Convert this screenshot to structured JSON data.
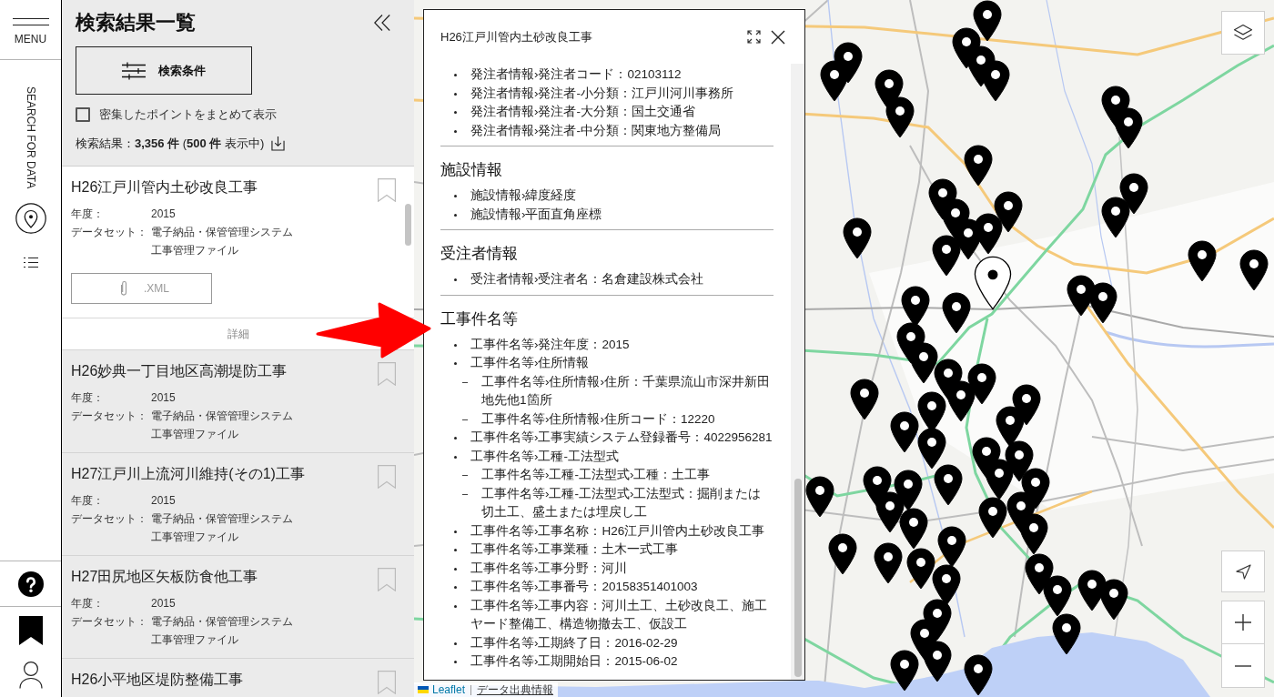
{
  "nav": {
    "menu_label": "MENU",
    "section_label": "SEARCH FOR DATA"
  },
  "results_panel": {
    "title": "検索結果一覧",
    "search_conditions_button": "検索条件",
    "cluster_option": {
      "label": "密集したポイントをまとめて表示",
      "checked": false
    },
    "summary": "検索結果：**3,356 件** (**500 件** 表示中)",
    "items": [
      {
        "title": "H26江戸川管内土砂改良工事",
        "selected": true,
        "bookmarked": false,
        "fields": [
          {
            "label": "年度：",
            "values": [
              "2015"
            ]
          },
          {
            "label": "データセット：",
            "values": [
              "電子納品・保管管理システム",
              "工事管理ファイル"
            ]
          }
        ],
        "attachment": ".XML",
        "detail_link": "詳細"
      },
      {
        "title": "H26妙典一丁目地区高潮堤防工事",
        "selected": false,
        "bookmarked": false,
        "fields": [
          {
            "label": "年度：",
            "values": [
              "2015"
            ]
          },
          {
            "label": "データセット：",
            "values": [
              "電子納品・保管管理システム",
              "工事管理ファイル"
            ]
          }
        ]
      },
      {
        "title": "H27江戸川上流河川維持(その1)工事",
        "selected": false,
        "bookmarked": false,
        "fields": [
          {
            "label": "年度：",
            "values": [
              "2015"
            ]
          },
          {
            "label": "データセット：",
            "values": [
              "電子納品・保管管理システム",
              "工事管理ファイル"
            ]
          }
        ]
      },
      {
        "title": "H27田尻地区矢板防食他工事",
        "selected": false,
        "bookmarked": false,
        "fields": [
          {
            "label": "年度：",
            "values": [
              "2015"
            ]
          },
          {
            "label": "データセット：",
            "values": [
              "電子納品・保管管理システム",
              "工事管理ファイル"
            ]
          }
        ]
      },
      {
        "title": "H26小平地区堤防整備工事",
        "selected": false,
        "bookmarked": false
      }
    ]
  },
  "popup": {
    "title": "H26江戸川管内土砂改良工事",
    "sections": [
      {
        "items": [
          {
            "text": "発注者情報›発注者コード：02103112"
          },
          {
            "text": "発注者情報›発注者-小分類：江戸川河川事務所"
          },
          {
            "text": "発注者情報›発注者-大分類：国土交通省"
          },
          {
            "text": "発注者情報›発注者-中分類：関東地方整備局"
          }
        ]
      },
      {
        "heading": "施設情報",
        "items": [
          {
            "text": "施設情報›緯度経度"
          },
          {
            "text": "施設情報›平面直角座標"
          }
        ]
      },
      {
        "heading": "受注者情報",
        "items": [
          {
            "text": "受注者情報›受注者名：名倉建設株式会社"
          }
        ]
      },
      {
        "heading": "工事件名等",
        "items": [
          {
            "text": "工事件名等›発注年度：2015"
          },
          {
            "text": "工事件名等›住所情報",
            "children": [
              {
                "text": "工事件名等›住所情報›住所：千葉県流山市深井新田地先他1箇所"
              },
              {
                "text": "工事件名等›住所情報›住所コード：12220"
              }
            ]
          },
          {
            "text": "工事件名等›工事実績システム登録番号：4022956281"
          },
          {
            "text": "工事件名等›工種-工法型式",
            "children": [
              {
                "text": "工事件名等›工種-工法型式›工種：土工事"
              },
              {
                "text": "工事件名等›工種-工法型式›工法型式：掘削または切土工、盛土または埋戻し工"
              }
            ]
          },
          {
            "text": "工事件名等›工事名称：H26江戸川管内土砂改良工事"
          },
          {
            "text": "工事件名等›工事業種：土木一式工事"
          },
          {
            "text": "工事件名等›工事分野：河川"
          },
          {
            "text": "工事件名等›工事番号：20158351401003"
          },
          {
            "text": "工事件名等›工事内容：河川土工、土砂改良工、施工ヤード整備工、構造物撤去工、仮設工"
          },
          {
            "text": "工事件名等›工期終了日：2016-02-29"
          },
          {
            "text": "工事件名等›工期開始日：2015-06-02"
          }
        ]
      }
    ]
  },
  "map": {
    "markers": [
      {
        "selected": false
      },
      {
        "selected": false
      },
      {
        "selected": false
      },
      {
        "selected": false
      },
      {
        "selected": false
      },
      {
        "selected": false
      },
      {
        "selected": false
      },
      {
        "selected": false
      },
      {
        "selected": false
      },
      {
        "selected": false
      },
      {
        "selected": false
      },
      {
        "selected": false
      },
      {
        "selected": false
      },
      {
        "selected": false
      },
      {
        "selected": false
      },
      {
        "selected": false
      },
      {
        "selected": false
      },
      {
        "selected": false
      },
      {
        "selected": false
      },
      {
        "selected": false
      },
      {
        "selected": false
      },
      {
        "selected": false
      },
      {
        "selected": true
      },
      {
        "selected": false
      },
      {
        "selected": false
      },
      {
        "selected": false
      },
      {
        "selected": false
      },
      {
        "selected": false
      },
      {
        "selected": false
      },
      {
        "selected": false
      },
      {
        "selected": false
      },
      {
        "selected": false
      },
      {
        "selected": false
      },
      {
        "selected": false
      },
      {
        "selected": false
      },
      {
        "selected": false
      },
      {
        "selected": false
      },
      {
        "selected": false
      },
      {
        "selected": false
      },
      {
        "selected": false
      },
      {
        "selected": false
      },
      {
        "selected": false
      },
      {
        "selected": false
      },
      {
        "selected": false
      },
      {
        "selected": false
      },
      {
        "selected": false
      },
      {
        "selected": false
      },
      {
        "selected": false
      },
      {
        "selected": false
      },
      {
        "selected": false
      },
      {
        "selected": false
      },
      {
        "selected": false
      },
      {
        "selected": false
      },
      {
        "selected": false
      },
      {
        "selected": false
      },
      {
        "selected": false
      },
      {
        "selected": false
      },
      {
        "selected": false
      },
      {
        "selected": false
      },
      {
        "selected": false
      },
      {
        "selected": false
      },
      {
        "selected": false
      },
      {
        "selected": false
      },
      {
        "selected": false
      },
      {
        "selected": false
      },
      {
        "selected": false
      }
    ],
    "attribution": {
      "library_link": "Leaflet",
      "source_link": "データ出典情報"
    }
  }
}
